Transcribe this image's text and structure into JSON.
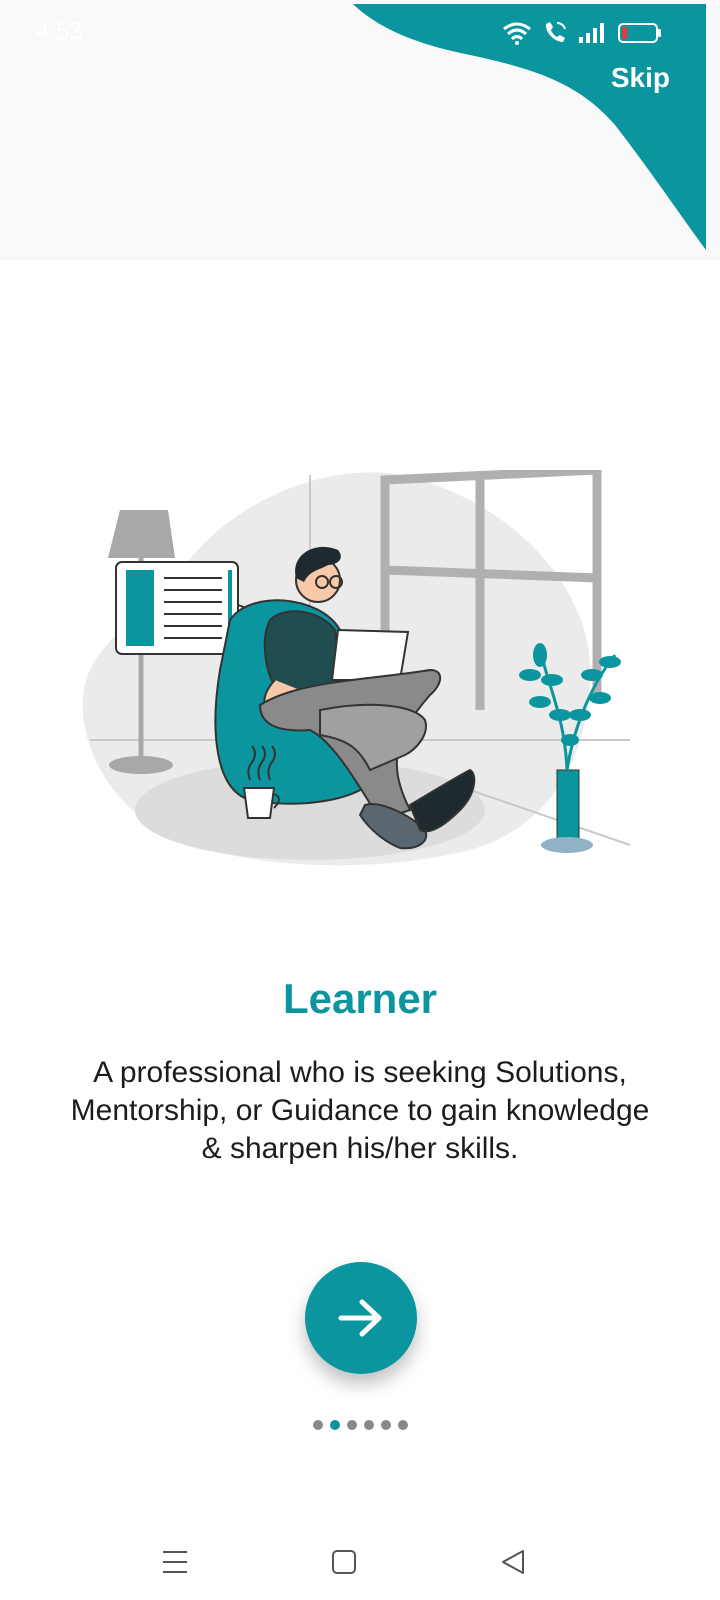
{
  "status_bar": {
    "time": "4:53",
    "icons": [
      "wifi-icon",
      "wifi-call-icon",
      "signal-icon",
      "battery-low-icon"
    ]
  },
  "header": {
    "skip_label": "Skip"
  },
  "onboarding": {
    "title": "Learner",
    "description_lines": [
      "A professional who is seeking Solutions,",
      "Mentorship, or Guidance to gain knowledge",
      "& sharpen his/her skills."
    ],
    "next_icon": "arrow-right-icon"
  },
  "pager": {
    "total": 6,
    "active_index": 1
  },
  "navigation_bar": {
    "icons": [
      "menu-icon",
      "home-square-icon",
      "back-triangle-icon"
    ]
  },
  "colors": {
    "accent": "#0b959e",
    "header_bg": "#f9f9f9",
    "text": "#1c1c1c",
    "dot_inactive": "#888888"
  }
}
